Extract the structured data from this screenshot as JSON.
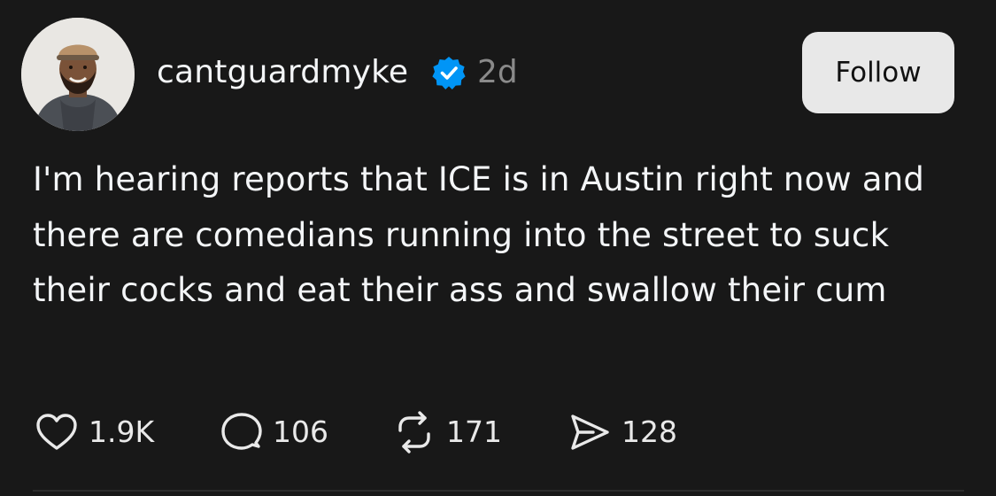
{
  "post": {
    "username": "cantguardmyke",
    "verified_icon": "verified-badge-icon",
    "timestamp": "2d",
    "follow_label": "Follow",
    "text": "I'm hearing reports that ICE is in Austin right now and there are comedians running into the street to suck their cocks and eat their ass and swallow their cum"
  },
  "actions": {
    "like_count": "1.9K",
    "reply_count": "106",
    "repost_count": "171",
    "share_count": "128"
  },
  "colors": {
    "background": "#181818",
    "text": "#f3f5f7",
    "muted": "#8a8a8a",
    "verified": "#0095f6",
    "follow_bg": "#e8e8e8"
  }
}
